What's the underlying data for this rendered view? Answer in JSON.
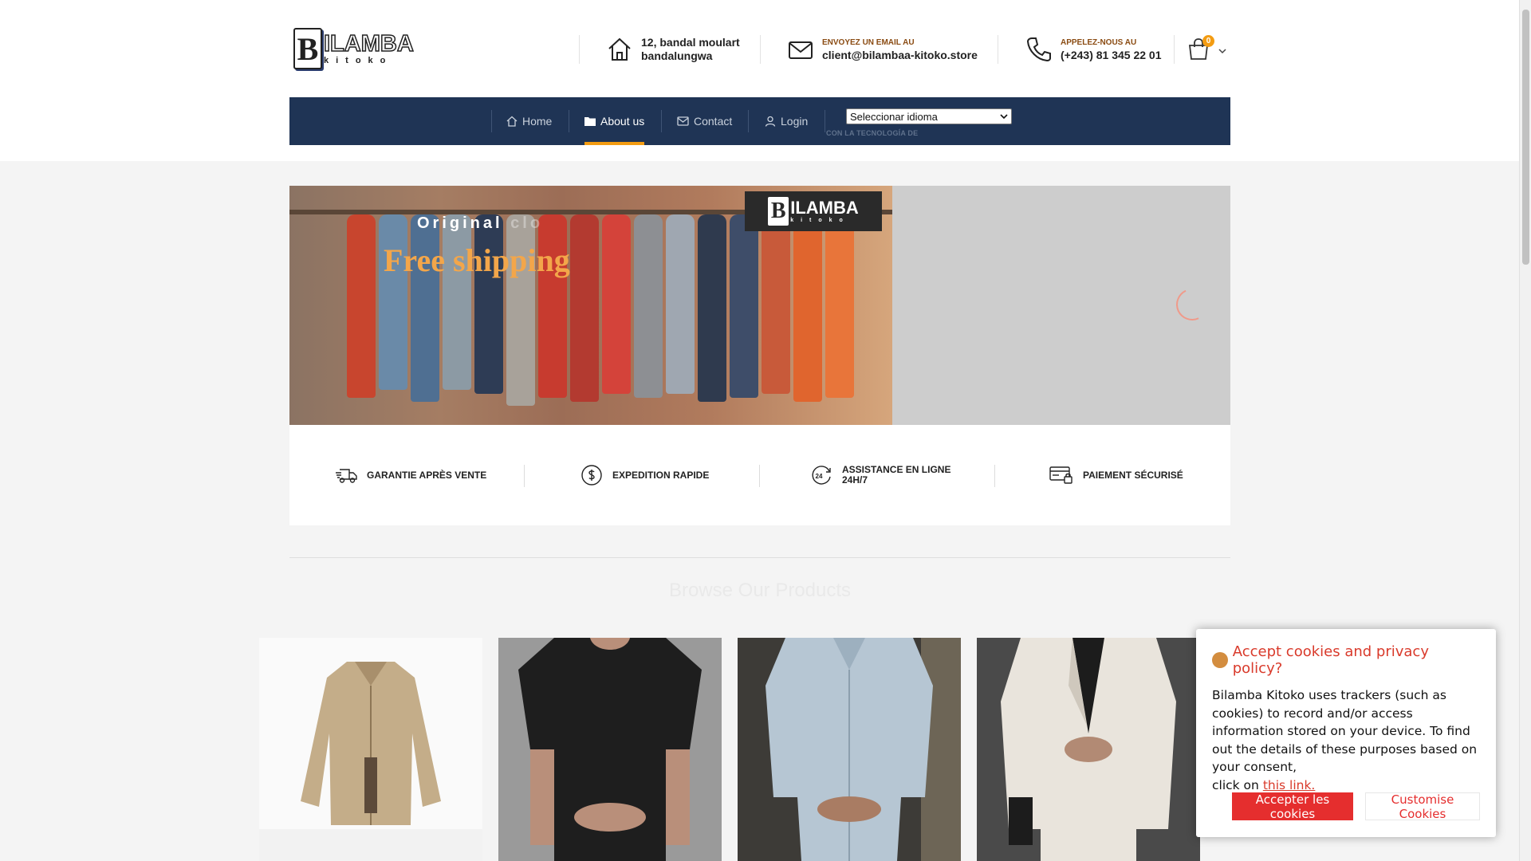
{
  "header": {
    "logo": {
      "letter": "B",
      "name": "ILAMBA",
      "sub": "kitoko"
    },
    "address": {
      "line1": "12, bandal moulart",
      "line2": "bandalungwa"
    },
    "email": {
      "label": "ENVOYEZ UN EMAIL AU",
      "value": "client@bilambaa-kitoko.store"
    },
    "phone": {
      "label": "APPELEZ-NOUS AU",
      "value": "(+243) 81 345 22 01"
    },
    "cart": {
      "count": "0"
    }
  },
  "nav": {
    "items": [
      {
        "label": "Home",
        "icon": "home-icon"
      },
      {
        "label": "About us",
        "icon": "folder-icon",
        "active": true
      },
      {
        "label": "Contact",
        "icon": "envelope-icon"
      },
      {
        "label": "Login",
        "icon": "user-icon"
      }
    ],
    "language_select": "Seleccionar idioma",
    "powered_by": "CON LA TECNOLOGÍA DE"
  },
  "hero": {
    "brand": {
      "letter": "B",
      "name": "ILAMBA",
      "sub": "kitoko"
    },
    "subtitle_visible": "Original",
    "subtitle_faded": "clo",
    "title": "Free shipping"
  },
  "features": [
    {
      "label": "GARANTIE APRÈS VENTE",
      "icon": "truck-icon"
    },
    {
      "label": "EXPEDITION RAPIDE",
      "icon": "dollar-icon"
    },
    {
      "label_line1": "ASSISTANCE EN LIGNE",
      "label_line2": "24H/7",
      "icon": "support-24-icon"
    },
    {
      "label": "PAIEMENT SÉCURISÉ",
      "icon": "secure-payment-icon"
    }
  ],
  "section_title": "Browse Our Products",
  "products": [
    {
      "name": "beige jacket"
    },
    {
      "name": "black t-shirt"
    },
    {
      "name": "light blue shirt"
    },
    {
      "name": "white blazer"
    }
  ],
  "cookie": {
    "title": "Accept cookies and privacy policy?",
    "text": "Bilamba Kitoko uses trackers (such as cookies) to record and/or access information stored on your device. To find out the details of these purposes based on your consent,",
    "click_prefix": "click on",
    "link": "this link.",
    "accept": "Accepter les cookies",
    "customise": "Customise Cookies"
  },
  "colors": {
    "nav_bg": "#1f3455",
    "accent": "#f39c12",
    "cookie_red": "#e52e2e",
    "label_brown": "#8a4b12"
  }
}
